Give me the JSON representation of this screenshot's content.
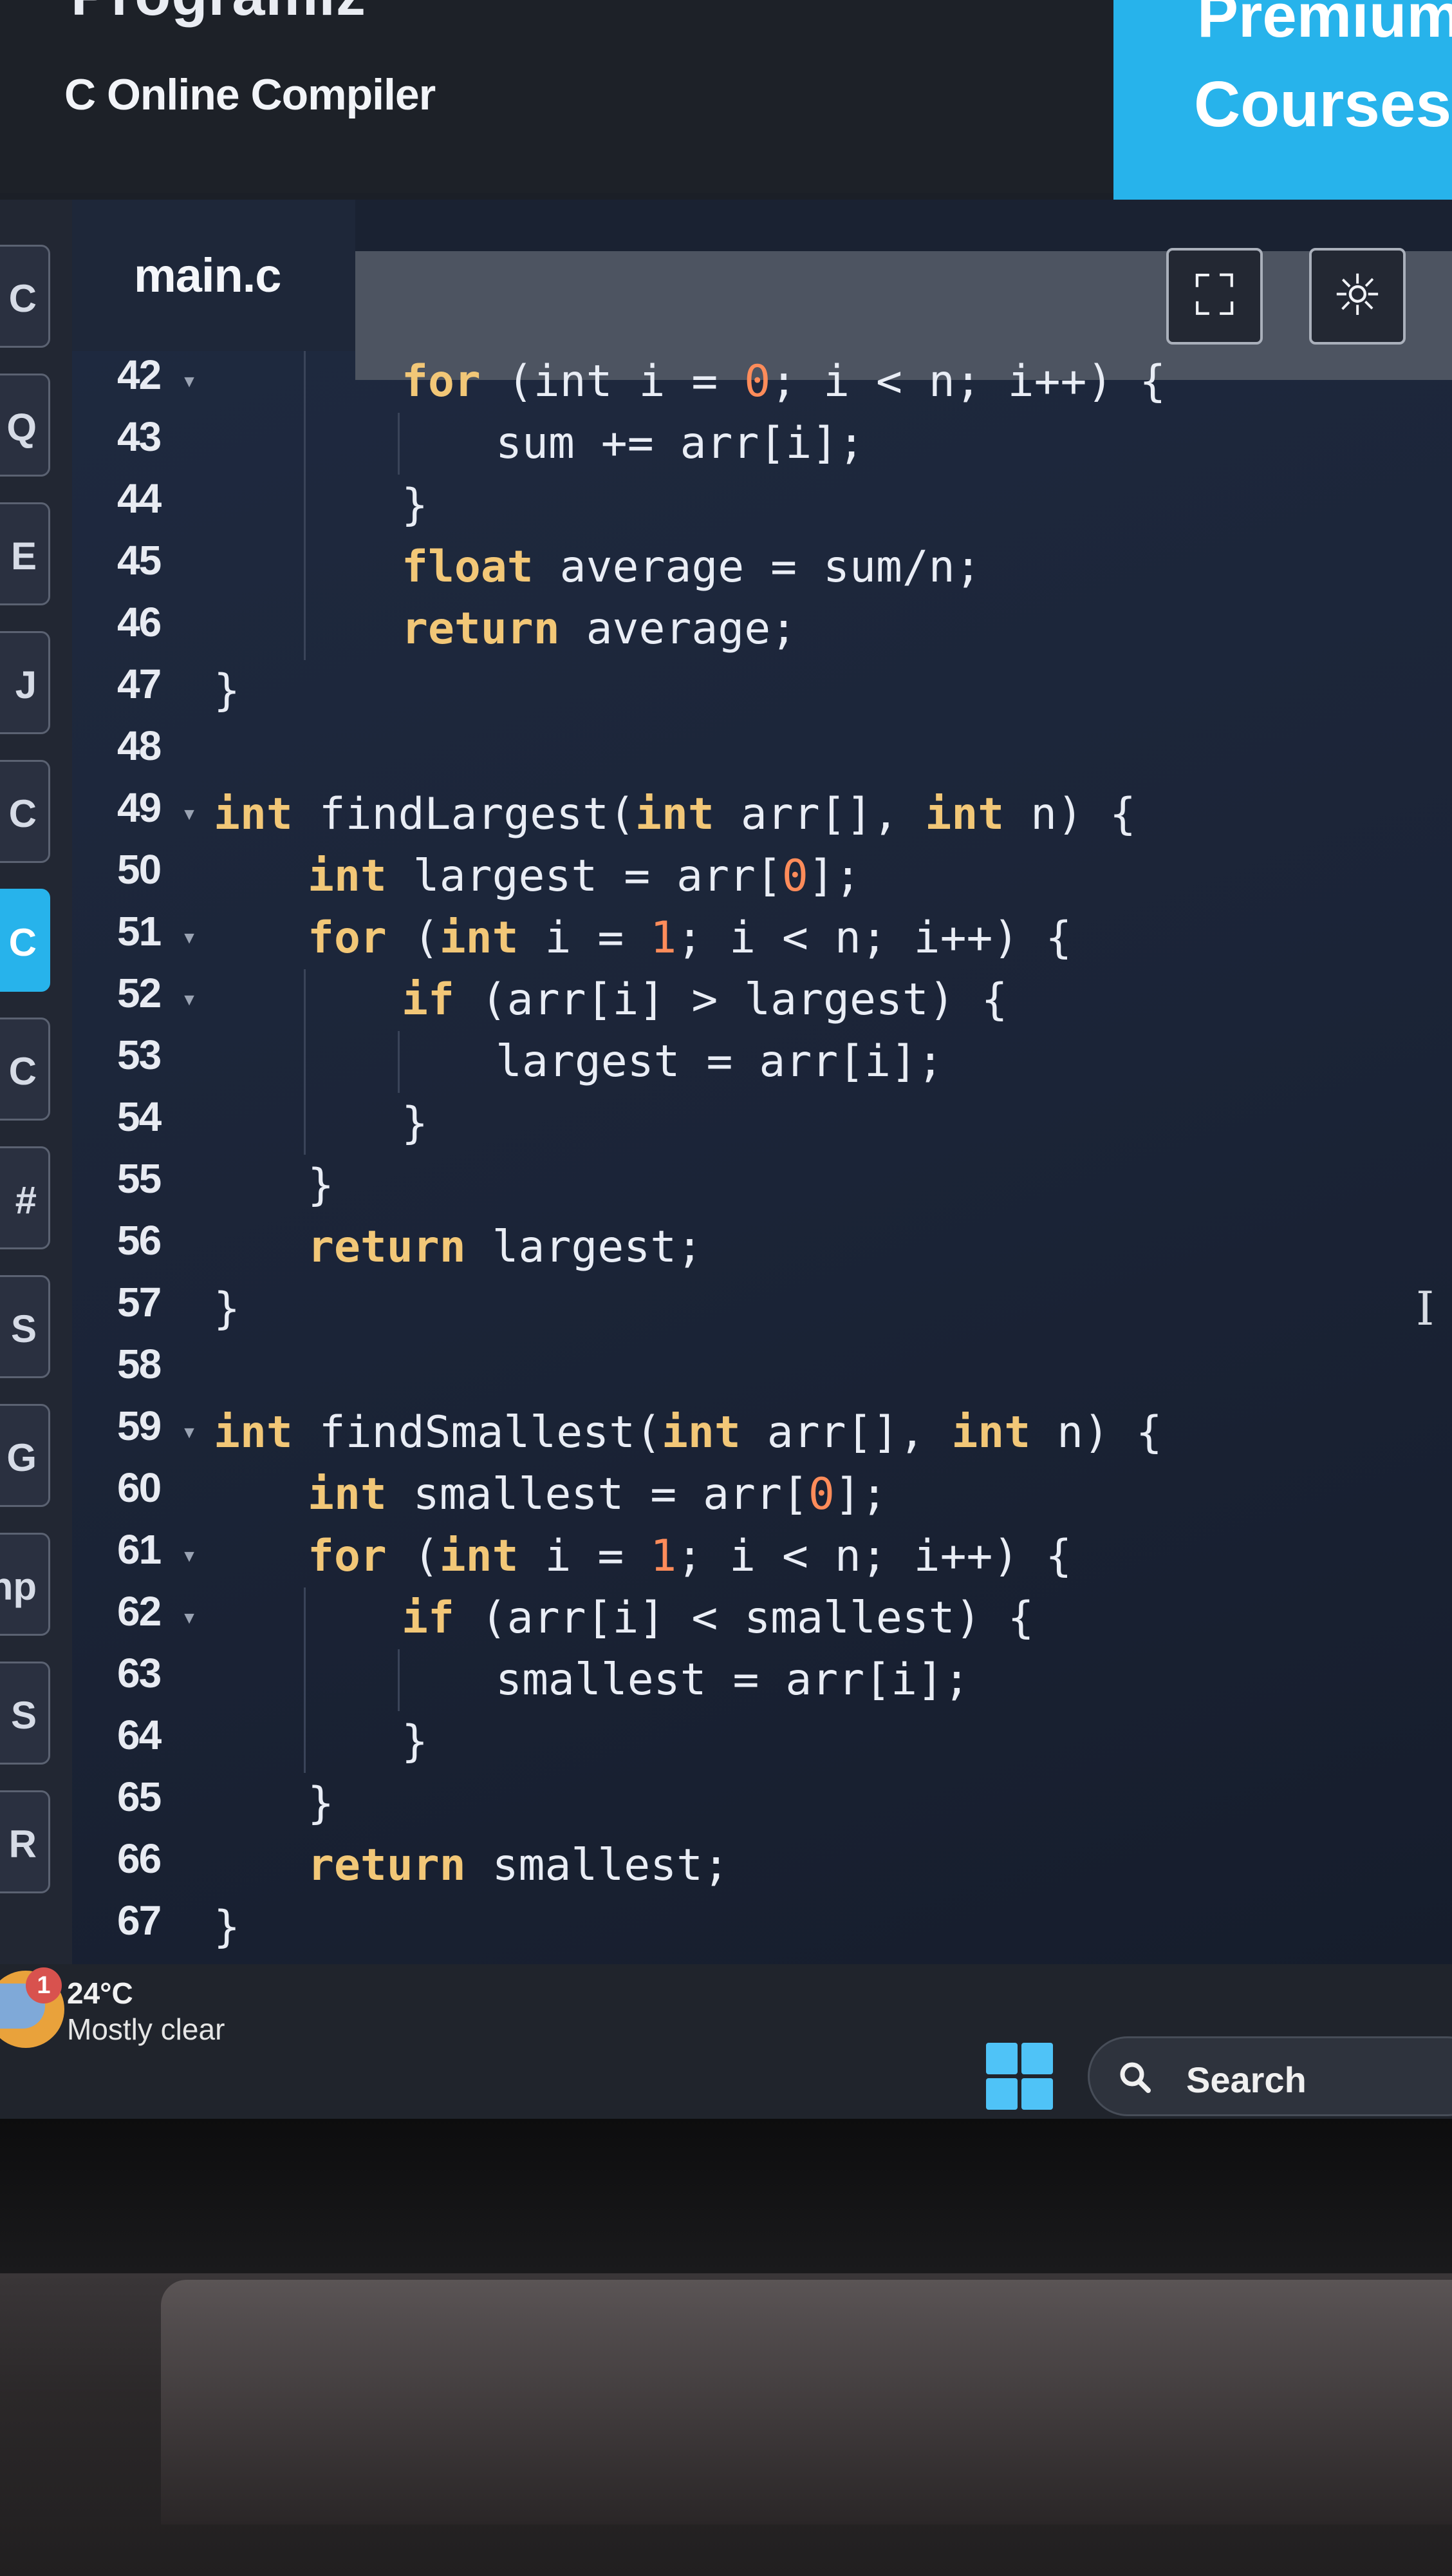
{
  "header": {
    "brand": "Programiz",
    "subtitle": "C Online Compiler",
    "premium_line1": "Premium",
    "premium_line2": "Courses"
  },
  "sidebar": {
    "items": [
      {
        "glyph": "C"
      },
      {
        "glyph": "Q"
      },
      {
        "glyph": "E"
      },
      {
        "glyph": "J"
      },
      {
        "glyph": "C"
      },
      {
        "glyph": "C",
        "active": true
      },
      {
        "glyph": "C"
      },
      {
        "glyph": "#"
      },
      {
        "glyph": "S"
      },
      {
        "glyph": "G"
      },
      {
        "glyph": "hp"
      },
      {
        "glyph": "S"
      },
      {
        "glyph": "R"
      }
    ]
  },
  "editor": {
    "tab_name": "main.c",
    "fullscreen_icon": "fullscreen-icon",
    "theme_icon": "sun-icon",
    "lines": [
      {
        "n": "42",
        "fold": true,
        "indent": 2,
        "tokens": [
          [
            "kw",
            "for"
          ],
          [
            "t",
            " (int i = "
          ],
          [
            "num",
            "0"
          ],
          [
            "t",
            "; i < n; i++) {"
          ]
        ]
      },
      {
        "n": "43",
        "fold": false,
        "indent": 3,
        "tokens": [
          [
            "t",
            "sum += arr[i];"
          ]
        ]
      },
      {
        "n": "44",
        "fold": false,
        "indent": 2,
        "tokens": [
          [
            "t",
            "}"
          ]
        ]
      },
      {
        "n": "45",
        "fold": false,
        "indent": 2,
        "tokens": [
          [
            "kw",
            "float"
          ],
          [
            "t",
            " average = sum/n;"
          ]
        ]
      },
      {
        "n": "46",
        "fold": false,
        "indent": 2,
        "tokens": [
          [
            "kw",
            "return"
          ],
          [
            "t",
            " average;"
          ]
        ]
      },
      {
        "n": "47",
        "fold": false,
        "indent": 0,
        "tokens": [
          [
            "t",
            "}"
          ]
        ]
      },
      {
        "n": "48",
        "fold": false,
        "indent": 0,
        "tokens": []
      },
      {
        "n": "49",
        "fold": true,
        "indent": 0,
        "tokens": [
          [
            "kw",
            "int"
          ],
          [
            "t",
            " findLargest("
          ],
          [
            "kw",
            "int"
          ],
          [
            "t",
            " arr[], "
          ],
          [
            "kw",
            "int"
          ],
          [
            "t",
            " n) {"
          ]
        ]
      },
      {
        "n": "50",
        "fold": false,
        "indent": 1,
        "tokens": [
          [
            "kw",
            "int"
          ],
          [
            "t",
            " largest = arr["
          ],
          [
            "num",
            "0"
          ],
          [
            "t",
            "];"
          ]
        ]
      },
      {
        "n": "51",
        "fold": true,
        "indent": 1,
        "tokens": [
          [
            "kw",
            "for"
          ],
          [
            "t",
            " ("
          ],
          [
            "kw",
            "int"
          ],
          [
            "t",
            " i = "
          ],
          [
            "num",
            "1"
          ],
          [
            "t",
            "; i < n; i++) {"
          ]
        ]
      },
      {
        "n": "52",
        "fold": true,
        "indent": 2,
        "tokens": [
          [
            "kw",
            "if"
          ],
          [
            "t",
            " (arr[i] > largest) {"
          ]
        ]
      },
      {
        "n": "53",
        "fold": false,
        "indent": 3,
        "tokens": [
          [
            "t",
            "largest = arr[i];"
          ]
        ]
      },
      {
        "n": "54",
        "fold": false,
        "indent": 2,
        "tokens": [
          [
            "t",
            "}"
          ]
        ]
      },
      {
        "n": "55",
        "fold": false,
        "indent": 1,
        "tokens": [
          [
            "t",
            "}"
          ]
        ]
      },
      {
        "n": "56",
        "fold": false,
        "indent": 1,
        "tokens": [
          [
            "kw",
            "return"
          ],
          [
            "t",
            " largest;"
          ]
        ]
      },
      {
        "n": "57",
        "fold": false,
        "indent": 0,
        "tokens": [
          [
            "t",
            "}"
          ]
        ]
      },
      {
        "n": "58",
        "fold": false,
        "indent": 0,
        "tokens": []
      },
      {
        "n": "59",
        "fold": true,
        "indent": 0,
        "tokens": [
          [
            "kw",
            "int"
          ],
          [
            "t",
            " findSmallest("
          ],
          [
            "kw",
            "int"
          ],
          [
            "t",
            " arr[], "
          ],
          [
            "kw",
            "int"
          ],
          [
            "t",
            " n) {"
          ]
        ]
      },
      {
        "n": "60",
        "fold": false,
        "indent": 1,
        "tokens": [
          [
            "kw",
            "int"
          ],
          [
            "t",
            " smallest = arr["
          ],
          [
            "num",
            "0"
          ],
          [
            "t",
            "];"
          ]
        ]
      },
      {
        "n": "61",
        "fold": true,
        "indent": 1,
        "tokens": [
          [
            "kw",
            "for"
          ],
          [
            "t",
            " ("
          ],
          [
            "kw",
            "int"
          ],
          [
            "t",
            " i = "
          ],
          [
            "num",
            "1"
          ],
          [
            "t",
            "; i < n; i++) {"
          ]
        ]
      },
      {
        "n": "62",
        "fold": true,
        "indent": 2,
        "tokens": [
          [
            "kw",
            "if"
          ],
          [
            "t",
            " (arr[i] < smallest) {"
          ]
        ]
      },
      {
        "n": "63",
        "fold": false,
        "indent": 3,
        "tokens": [
          [
            "t",
            "smallest = arr[i];"
          ]
        ]
      },
      {
        "n": "64",
        "fold": false,
        "indent": 2,
        "tokens": [
          [
            "t",
            "}"
          ]
        ]
      },
      {
        "n": "65",
        "fold": false,
        "indent": 1,
        "tokens": [
          [
            "t",
            "}"
          ]
        ]
      },
      {
        "n": "66",
        "fold": false,
        "indent": 1,
        "tokens": [
          [
            "kw",
            "return"
          ],
          [
            "t",
            " smallest;"
          ]
        ]
      },
      {
        "n": "67",
        "fold": false,
        "indent": 0,
        "tokens": [
          [
            "t",
            "}"
          ]
        ]
      }
    ]
  },
  "taskbar": {
    "weather_badge": "1",
    "weather_temp": "24°C",
    "weather_desc": "Mostly clear",
    "search_label": "Search"
  },
  "colors": {
    "accent": "#27b3eb",
    "keyword": "#f2c777",
    "number": "#ff8c5a",
    "text": "#e9edf5",
    "editor_bg": "#1d2639"
  }
}
